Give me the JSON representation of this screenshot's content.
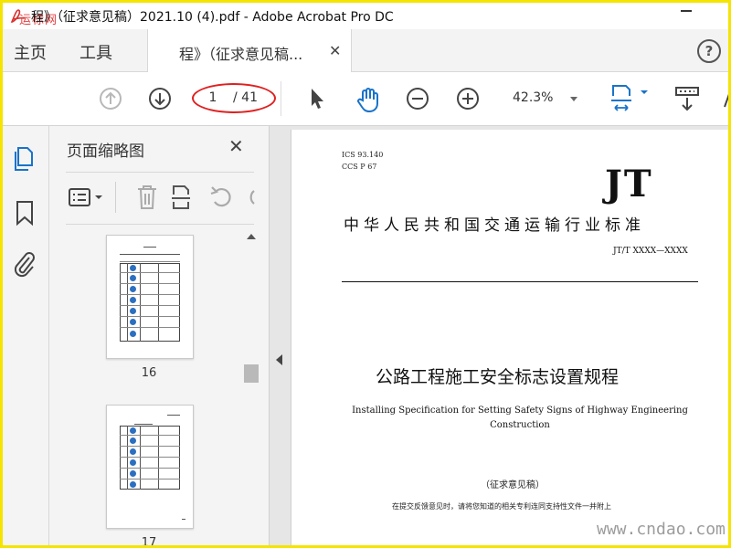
{
  "window": {
    "title": "程》（征求意见稿）2021.10 (4).pdf - Adobe Acrobat Pro DC",
    "corner_watermark": "运标网"
  },
  "tabs": {
    "home": "主页",
    "tools": "工具",
    "document": "程》（征求意见稿..."
  },
  "toolbar": {
    "current_page": "1",
    "total_pages": "/ 41",
    "zoom": "42.3%"
  },
  "thumbnails_panel": {
    "title": "页面缩略图",
    "pages": [
      {
        "label": "16"
      },
      {
        "label": "17"
      }
    ]
  },
  "document": {
    "ics": "ICS 93.140",
    "ccs": "CCS P 67",
    "logo": "JT",
    "standard_title_cn": "中华人民共和国交通运输行业标准",
    "standard_number": "JT/T XXXX—XXXX",
    "title_cn": "公路工程施工安全标志设置规程",
    "title_en_line1": "Installing Specification for Setting Safety Signs of Highway Engineering",
    "title_en_line2": "Construction",
    "draft_label": "（征求意见稿）",
    "note": "在提交反馈意见时，请将您知道的相关专利连同支持性文件一并附上"
  },
  "site_watermark": "www.cndao.com",
  "colors": {
    "frame_border": "#f5e400",
    "accent_blue": "#1a73c9",
    "annotation_red": "#e02020"
  }
}
